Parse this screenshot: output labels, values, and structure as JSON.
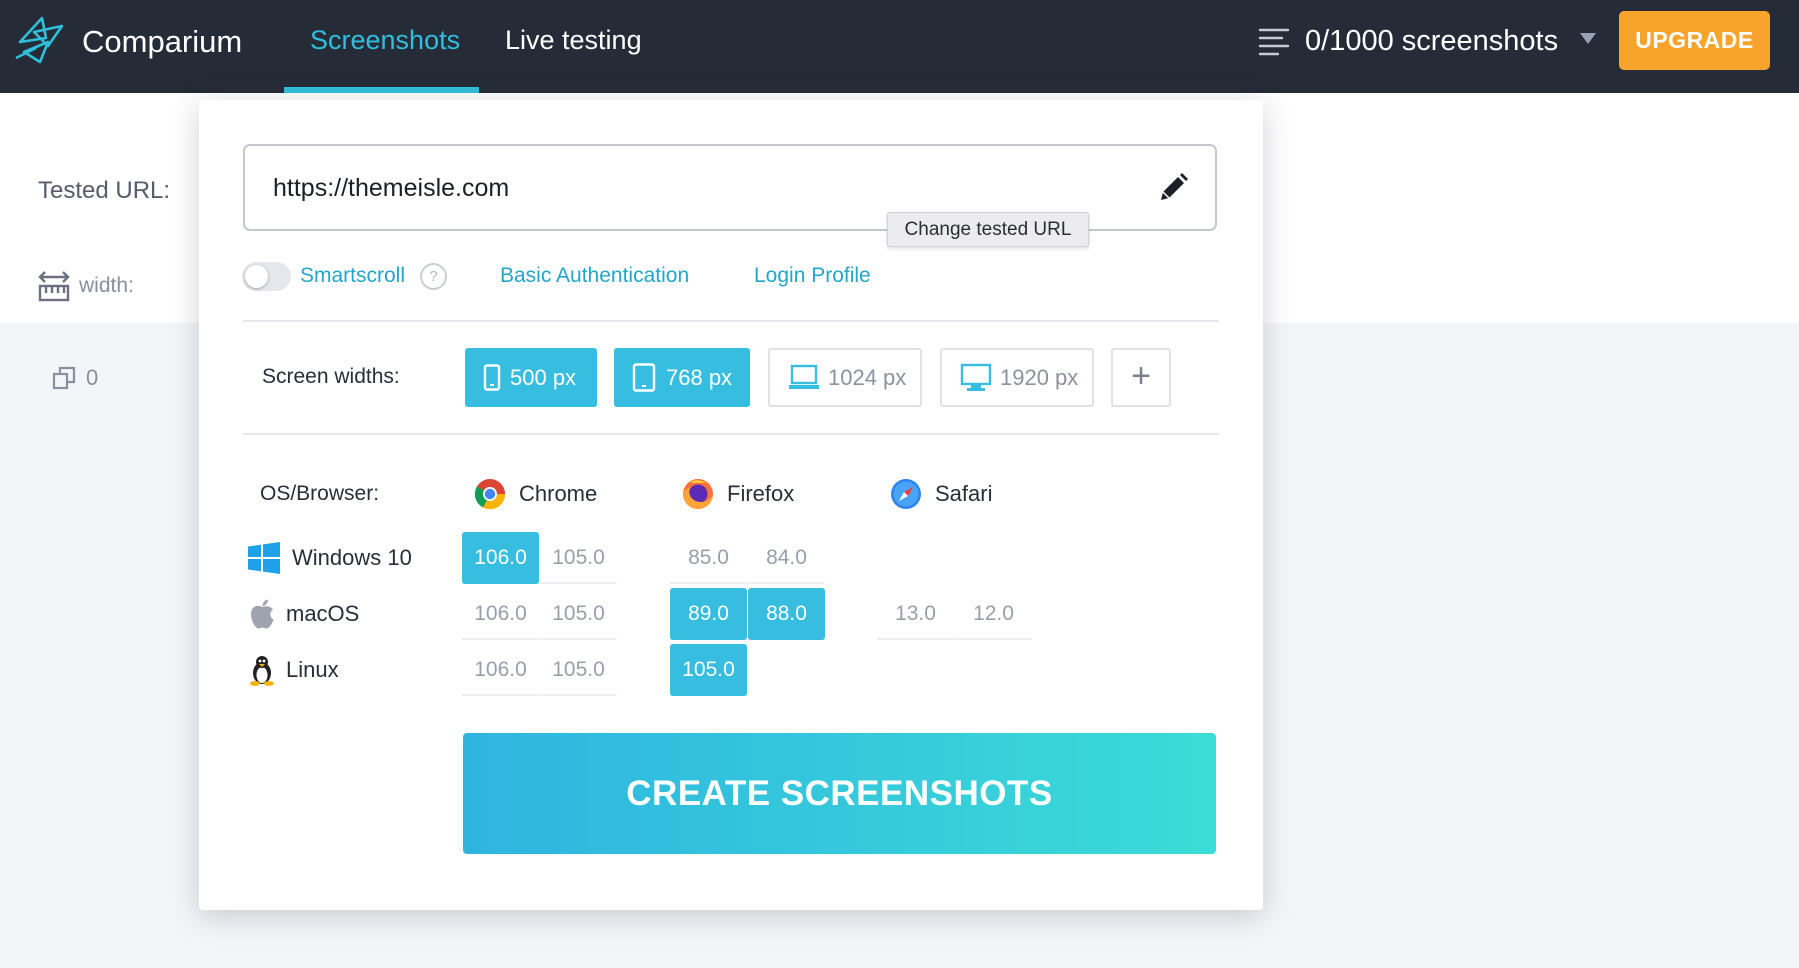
{
  "header": {
    "brand": "Comparium",
    "tabs": [
      {
        "label": "Screenshots",
        "active": true
      },
      {
        "label": "Live testing",
        "active": false
      }
    ],
    "quota": "0/1000 screenshots",
    "upgrade": "UPGRADE",
    "accent_color": "#30bfdb",
    "upgrade_color": "#f7a32c"
  },
  "background": {
    "tested_url_label": "Tested URL:",
    "width_label": "width:",
    "count": "0"
  },
  "form": {
    "url": "https://themeisle.com",
    "tooltip": "Change tested URL",
    "smartscroll": {
      "label": "Smartscroll",
      "enabled": false,
      "help": "?"
    },
    "basic_auth": "Basic Authentication",
    "login_profile": "Login Profile",
    "screen_widths_label": "Screen widths:",
    "widths": [
      {
        "label": "500 px",
        "device": "phone-icon",
        "selected": true
      },
      {
        "label": "768 px",
        "device": "tablet-icon",
        "selected": true
      },
      {
        "label": "1024 px",
        "device": "laptop-icon",
        "selected": false
      },
      {
        "label": "1920 px",
        "device": "monitor-icon",
        "selected": false
      }
    ],
    "add_width": "+",
    "os_browser_label": "OS/Browser:",
    "browsers": [
      {
        "name": "Chrome",
        "icon": "chrome-icon"
      },
      {
        "name": "Firefox",
        "icon": "firefox-icon"
      },
      {
        "name": "Safari",
        "icon": "safari-icon"
      }
    ],
    "os_rows": [
      {
        "name": "Windows 10",
        "icon": "windows-icon",
        "chrome": [
          {
            "v": "106.0",
            "on": true
          },
          {
            "v": "105.0",
            "on": false
          }
        ],
        "firefox": [
          {
            "v": "85.0",
            "on": false
          },
          {
            "v": "84.0",
            "on": false
          }
        ],
        "safari": []
      },
      {
        "name": "macOS",
        "icon": "apple-icon",
        "chrome": [
          {
            "v": "106.0",
            "on": false
          },
          {
            "v": "105.0",
            "on": false
          }
        ],
        "firefox": [
          {
            "v": "89.0",
            "on": true
          },
          {
            "v": "88.0",
            "on": true
          }
        ],
        "safari": [
          {
            "v": "13.0",
            "on": false
          },
          {
            "v": "12.0",
            "on": false
          }
        ]
      },
      {
        "name": "Linux",
        "icon": "linux-icon",
        "chrome": [
          {
            "v": "106.0",
            "on": false
          },
          {
            "v": "105.0",
            "on": false
          }
        ],
        "firefox": [
          {
            "v": "105.0",
            "on": true
          }
        ],
        "safari": []
      }
    ],
    "create_button": "CREATE SCREENSHOTS"
  }
}
